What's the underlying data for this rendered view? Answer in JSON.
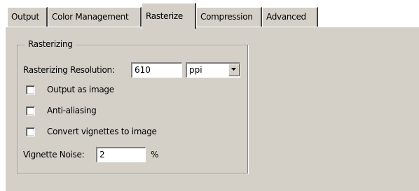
{
  "tabs": [
    {
      "label": "Output",
      "active": false
    },
    {
      "label": "Color Management",
      "active": false
    },
    {
      "label": "Rasterize",
      "active": true
    },
    {
      "label": "Compression",
      "active": false
    },
    {
      "label": "Advanced",
      "active": false
    }
  ],
  "rasterizing": {
    "group_label": "Rasterizing",
    "resolution": {
      "label": "Rasterizing Resolution:",
      "value": "610",
      "unit": "ppi"
    },
    "output_as_image": {
      "label": "Output as image",
      "checked": false
    },
    "anti_aliasing": {
      "label": "Anti-aliasing",
      "checked": false
    },
    "convert_vignettes": {
      "label": "Convert vignettes to image",
      "checked": false
    },
    "vignette_noise": {
      "label": "Vignette Noise:",
      "value": "2",
      "unit": "%"
    }
  },
  "colors": {
    "face": "#d4d0c8"
  },
  "icons": {
    "dropdown": "chevron-down-icon"
  }
}
